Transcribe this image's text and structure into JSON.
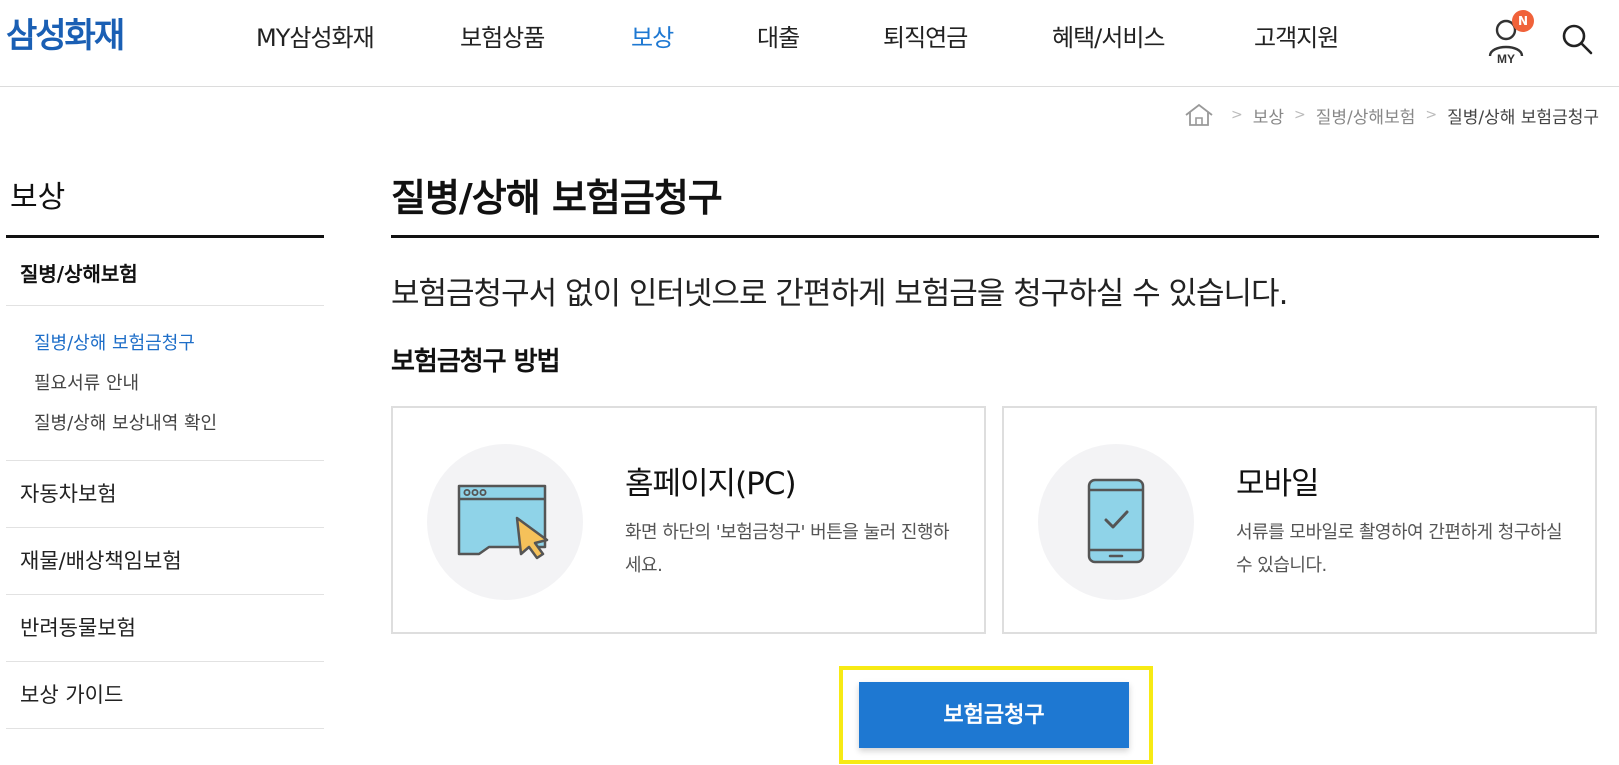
{
  "header": {
    "logo": "삼성화재",
    "nav": [
      {
        "label": "MY삼성화재",
        "active": false
      },
      {
        "label": "보험상품",
        "active": false
      },
      {
        "label": "보상",
        "active": true
      },
      {
        "label": "대출",
        "active": false
      },
      {
        "label": "퇴직연금",
        "active": false
      },
      {
        "label": "혜택/서비스",
        "active": false
      },
      {
        "label": "고객지원",
        "active": false
      }
    ],
    "my_label": "MY",
    "my_badge": "N",
    "icons": {
      "my": "my-user-icon",
      "search": "search-icon"
    }
  },
  "breadcrumb": {
    "home_icon": "home-icon",
    "items": [
      "보상",
      "질병/상해보험",
      "질병/상해 보험금청구"
    ]
  },
  "lnb": {
    "title": "보상",
    "group_head": "질병/상해보험",
    "sub_items": [
      {
        "label": "질병/상해 보험금청구",
        "active": true
      },
      {
        "label": "필요서류 안내",
        "active": false
      },
      {
        "label": "질병/상해 보상내역 확인",
        "active": false
      }
    ],
    "items": [
      "자동차보험",
      "재물/배상책임보험",
      "반려동물보험",
      "보상 가이드"
    ]
  },
  "main": {
    "title": "질병/상해 보험금청구",
    "lead": "보험금청구서 없이 인터넷으로 간편하게 보험금을 청구하실 수 있습니다.",
    "section_title": "보험금청구 방법",
    "cards": [
      {
        "title": "홈페이지(PC)",
        "desc": "화면 하단의 '보험금청구' 버튼을 눌러 진행하세요.",
        "icon": "browser-cursor-icon"
      },
      {
        "title": "모바일",
        "desc": "서류를 모바일로 촬영하여 간편하게 청구하실 수 있습니다.",
        "icon": "mobile-check-icon"
      }
    ],
    "claim_button": "보험금청구"
  },
  "colors": {
    "brand": "#1a5fb4",
    "accent": "#1e78d2",
    "badge": "#f0623a",
    "highlight": "#f7ea14",
    "icon_fill": "#8fd3e8",
    "cursor_fill": "#f5c15a"
  }
}
